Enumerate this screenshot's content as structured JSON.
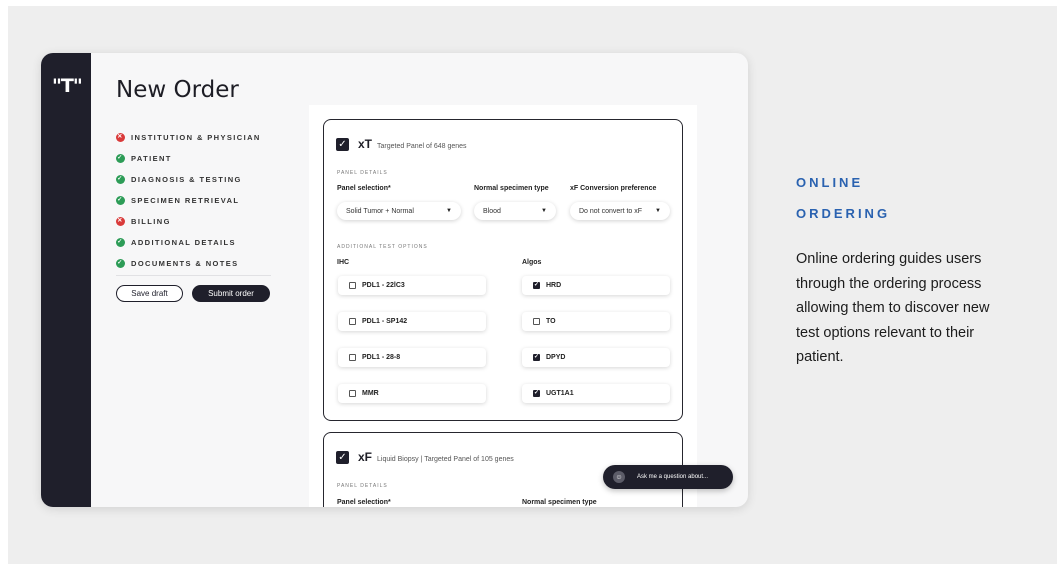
{
  "app": {
    "logo": "\"T\"",
    "title": "New Order"
  },
  "steps": [
    {
      "label": "INSTITUTION & PHYSICIAN",
      "status": "error"
    },
    {
      "label": "PATIENT",
      "status": "complete"
    },
    {
      "label": "DIAGNOSIS & TESTING",
      "status": "complete"
    },
    {
      "label": "SPECIMEN RETRIEVAL",
      "status": "complete"
    },
    {
      "label": "BILLING",
      "status": "error"
    },
    {
      "label": "ADDITIONAL DETAILS",
      "status": "complete"
    },
    {
      "label": "DOCUMENTS & NOTES",
      "status": "complete"
    }
  ],
  "actions": {
    "save_draft": "Save draft",
    "submit_order": "Submit order"
  },
  "panels": {
    "xt": {
      "name": "xT",
      "description": "Targeted Panel of 648 genes",
      "checked": true,
      "panel_details_label": "PANEL DETAILS",
      "fields": {
        "panel_selection_label": "Panel selection*",
        "panel_selection_value": "Solid Tumor + Normal",
        "normal_specimen_label": "Normal specimen type",
        "normal_specimen_value": "Blood",
        "conversion_label": "xF Conversion preference",
        "conversion_value": "Do not convert to xF"
      },
      "additional_label": "ADDITIONAL TEST OPTIONS",
      "ihc_label": "IHC",
      "algos_label": "Algos",
      "ihc_options": [
        {
          "label": "PDL1 - 22lC3",
          "checked": false
        },
        {
          "label": "PDL1 - SP142",
          "checked": false
        },
        {
          "label": "PDL1 - 28-8",
          "checked": false
        },
        {
          "label": "MMR",
          "checked": false
        }
      ],
      "algo_options": [
        {
          "label": "HRD",
          "checked": true
        },
        {
          "label": "TO",
          "checked": false
        },
        {
          "label": "DPYD",
          "checked": true
        },
        {
          "label": "UGT1A1",
          "checked": true
        }
      ]
    },
    "xf": {
      "name": "xF",
      "description": "Liquid Biopsy | Targeted Panel of 105 genes",
      "checked": true,
      "panel_details_label": "PANEL DETAILS",
      "panel_selection_label": "Panel selection*",
      "normal_specimen_label": "Normal specimen type"
    }
  },
  "assistant": {
    "placeholder": "Ask me a question about..."
  },
  "aside": {
    "heading_line1": "ONLINE",
    "heading_line2": "ORDERING",
    "description": "Online ordering guides users through the ordering process allowing them to discover new test options relevant to their patient."
  },
  "colors": {
    "rail": "#1f1f2b",
    "accent_blue": "#2a62b0",
    "complete": "#2d9c57",
    "error": "#d93a3a"
  },
  "icons": {
    "complete": "checkmark-circle-icon",
    "error": "x-circle-icon",
    "dropdown": "caret-down-icon",
    "assistant": "chat-bot-icon"
  }
}
